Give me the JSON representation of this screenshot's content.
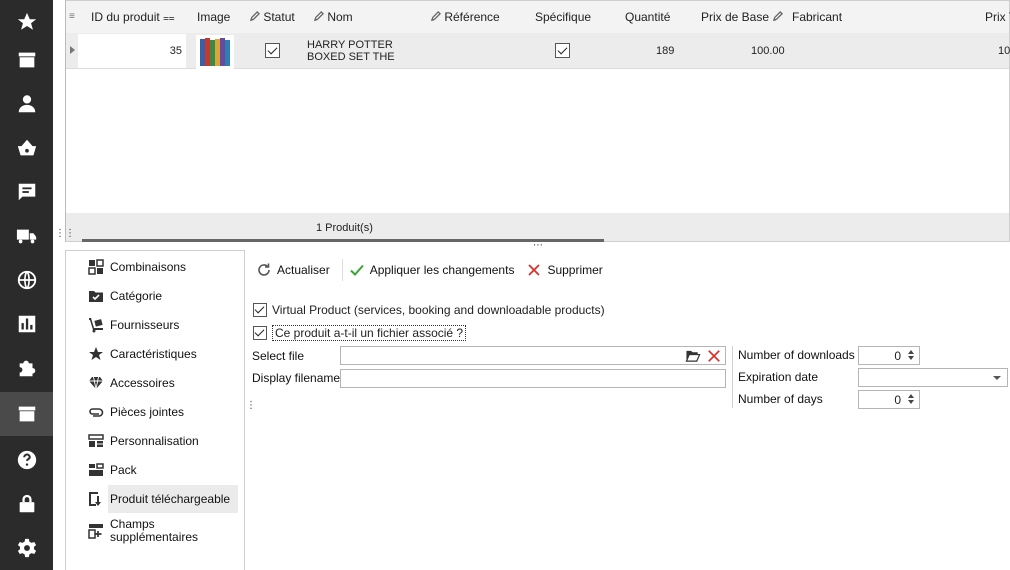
{
  "sidebar": {
    "icons": [
      "star-icon",
      "store-icon",
      "user-icon",
      "basket-icon",
      "chat-icon",
      "truck-icon",
      "globe-icon",
      "chart-icon",
      "puzzle-icon",
      "box-icon",
      "help-icon",
      "lock-icon",
      "gear-icon"
    ],
    "active_index": 9
  },
  "grid": {
    "columns": {
      "id": "ID du produit",
      "image": "Image",
      "status": "Statut",
      "name": "Nom",
      "reference": "Référence",
      "specific": "Spécifique",
      "quantity": "Quantité",
      "base_price": "Prix de Base",
      "manufacturer": "Fabricant",
      "price_truncated": "Prix T"
    },
    "rows": [
      {
        "id": "35",
        "status_checked": true,
        "name_line1": "HARRY POTTER",
        "name_line2": "BOXED SET THE",
        "reference": "",
        "specific_checked": true,
        "quantity": "189",
        "base_price": "100.00",
        "manufacturer": "",
        "price_truncated": "10"
      }
    ],
    "footer": "1 Produit(s)"
  },
  "subnav": {
    "items": [
      {
        "label": "Combinaisons",
        "icon": "combinations-icon"
      },
      {
        "label": "Catégorie",
        "icon": "folder-check-icon"
      },
      {
        "label": "Fournisseurs",
        "icon": "dolly-icon"
      },
      {
        "label": "Caractéristiques",
        "icon": "star-icon"
      },
      {
        "label": "Accessoires",
        "icon": "diamond-icon"
      },
      {
        "label": "Pièces jointes",
        "icon": "paperclip-icon"
      },
      {
        "label": "Personnalisation",
        "icon": "customize-icon"
      },
      {
        "label": "Pack",
        "icon": "pack-icon"
      },
      {
        "label": "Produit téléchargeable",
        "icon": "download-icon"
      },
      {
        "label_line1": "Champs",
        "label_line2": "supplémentaires",
        "icon": "add-fields-icon"
      }
    ],
    "active_index": 8
  },
  "toolbar": {
    "refresh": "Actualiser",
    "apply": "Appliquer les changements",
    "delete": "Supprimer"
  },
  "form": {
    "virtual_product": "Virtual Product (services, booking and downloadable products)",
    "has_file": "Ce produit a-t-il un fichier associé ?",
    "select_file_label": "Select file",
    "select_file_value": "",
    "display_filename_label": "Display filename",
    "display_filename_value": "",
    "num_downloads_label": "Number of downloads",
    "num_downloads_value": "0",
    "expiration_label": "Expiration date",
    "expiration_value": "",
    "num_days_label": "Number of days",
    "num_days_value": "0"
  },
  "colors": {
    "sidebar_bg": "#2b2b2b",
    "apply_green": "#3aa63a",
    "delete_red": "#d9302c"
  }
}
